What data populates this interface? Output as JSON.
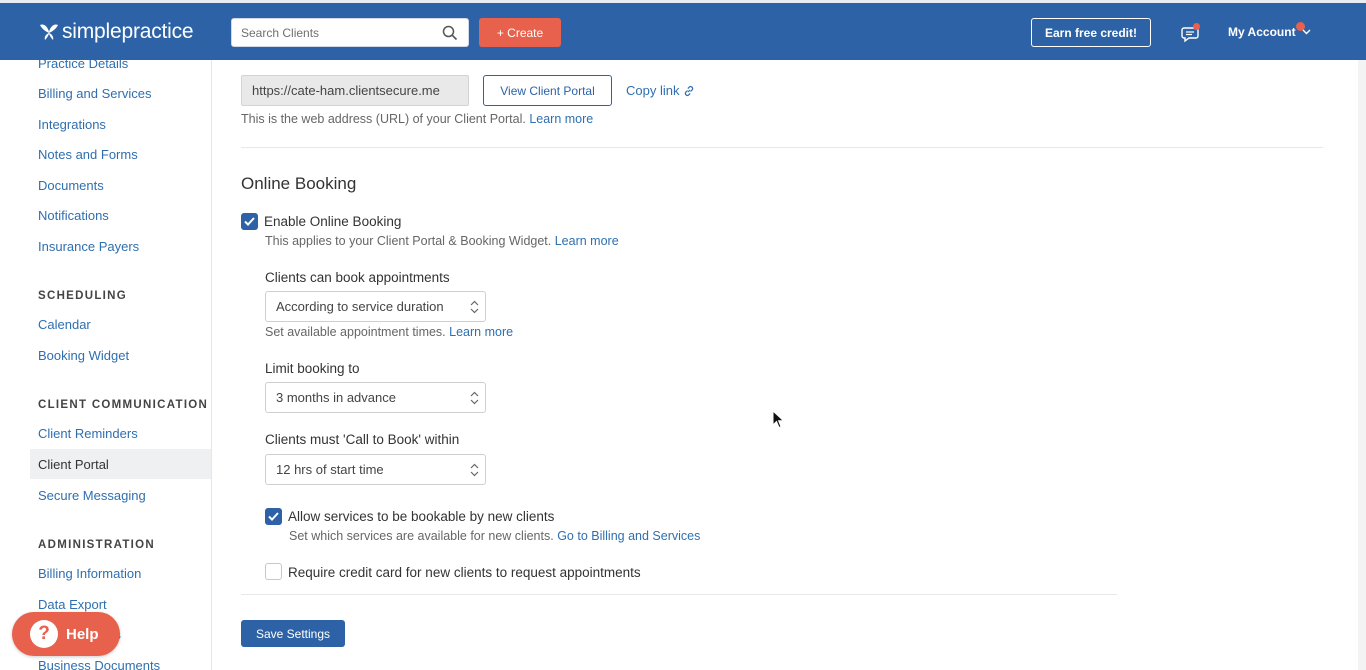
{
  "header": {
    "logo_text": "simplepractice",
    "search_placeholder": "Search Clients",
    "create_label": "+ Create",
    "earn_credit_label": "Earn free credit!",
    "account_label": "My Account",
    "colors": {
      "brand": "#2d63a6",
      "accent": "#e8614d"
    }
  },
  "sidebar": {
    "items_top": [
      "Practice Details",
      "Billing and Services",
      "Integrations",
      "Notes and Forms",
      "Documents",
      "Notifications",
      "Insurance Payers"
    ],
    "scheduling_heading": "SCHEDULING",
    "scheduling_items": [
      "Calendar",
      "Booking Widget"
    ],
    "communication_heading": "CLIENT COMMUNICATION",
    "communication_items": [
      "Client Reminders",
      "Client Portal",
      "Secure Messaging"
    ],
    "administration_heading": "ADMINISTRATION",
    "administration_items": [
      "Billing Information",
      "Data Export",
      "rs",
      "Business Documents"
    ]
  },
  "portal": {
    "url_value": "https://cate-ham.clientsecure.me",
    "view_portal_label": "View Client Portal",
    "copy_link_label": "Copy link",
    "url_help": "This is the web address (URL) of your Client Portal.",
    "learn_more": "Learn more"
  },
  "booking": {
    "title": "Online Booking",
    "enable_label": "Enable Online Booking",
    "enable_help": "This applies to your Client Portal & Booking Widget.",
    "learn_more": "Learn more",
    "book_label": "Clients can book appointments",
    "book_value": "According to service duration",
    "book_help": "Set available appointment times.",
    "limit_label": "Limit booking to",
    "limit_value": "3 months in advance",
    "call_label": "Clients must 'Call to Book' within",
    "call_value": "12 hrs of start time",
    "allow_new_label": "Allow services to be bookable by new clients",
    "allow_new_help": "Set which services are available for new clients.",
    "allow_new_link": "Go to Billing and Services",
    "require_cc_label": "Require credit card for new clients to request appointments",
    "save_label": "Save Settings"
  },
  "help_widget": {
    "label": "Help",
    "icon": "?"
  }
}
